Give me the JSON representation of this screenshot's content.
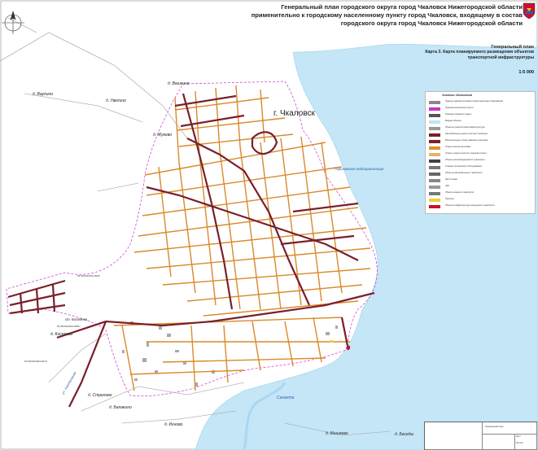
{
  "title": {
    "line1": "Генеральный план городского округа город Чкаловск Нижегородской области",
    "line2": "применительно к городскому населенному пункту город Чкаловск, входящему в состав",
    "line3": "городского округа город Чкаловск Нижегородской области"
  },
  "subtitle": {
    "line1": "Генеральный план",
    "line2": "Карта 3. Карта планируемого размещения объектов",
    "line3": "транспортной инфраструктуры"
  },
  "scale": "1:5 000",
  "labels": {
    "city": "г. Чкаловск",
    "reservoir": "Горьковское водохранилище",
    "river": "Санахта",
    "vashkino": "д. Вашкино",
    "vaulino": "д. Ваулино",
    "uvelino": "д. Увелино",
    "zhukovo": "д. Жуково",
    "kostyanka": "ст. Костянка",
    "kiselevo": "д. Киселево",
    "strelovo": "д. Стрелово",
    "balakino": "д. Балакино",
    "ignovo": "д. Игново",
    "mishino": "д. Мишнево",
    "besedy": "д. Беседы",
    "road": "ул. Аэродромная",
    "cad1": "52:08:0010304:4000",
    "cad2": "52:08:0010304:1886",
    "cad3": "52:08:0010304:4079"
  },
  "legend": {
    "header": "Условные обозначения",
    "items": [
      {
        "text": "Границы административно-территориальных образований",
        "color": "#888888"
      },
      {
        "text": "Граница населенного пункта",
        "color": "#cc33cc"
      },
      {
        "text": "Граница городского округа",
        "color": "#555555"
      },
      {
        "text": "Водные объекты",
        "color": "#bfe3f5"
      },
      {
        "text": "Объекты транспортной инфраструктуры",
        "color": "#999999"
      },
      {
        "text": "Автомобильные дороги местного значения",
        "color": "#7a1f2b"
      },
      {
        "text": "Магистральные улицы районного значения",
        "color": "#7a1f2b"
      },
      {
        "text": "Улицы в жилой застройке",
        "color": "#e0902a"
      },
      {
        "text": "Улицы и дороги местного значения (план.)",
        "color": "#e8b070"
      },
      {
        "text": "Объекты железнодорожного транспорта",
        "color": "#444444"
      },
      {
        "text": "Станции технического обслуживания",
        "color": "#777777"
      },
      {
        "text": "Объекты автомобильного транспорта",
        "color": "#666666"
      },
      {
        "text": "Автостоянки",
        "color": "#888888"
      },
      {
        "text": "АЗС",
        "color": "#999999"
      },
      {
        "text": "Объекты водного транспорта",
        "color": "#777777"
      },
      {
        "text": "Причалы",
        "color": "#e8d23a"
      },
      {
        "text": "Объекты инфраструктуры воздушного транспорта",
        "color": "#c8102e"
      }
    ]
  },
  "stamp": {
    "org": "Генеральный план",
    "sheet": "Лист",
    "sheets": "Листов"
  },
  "colors": {
    "water": "#c4e6f7",
    "land": "#ffffff",
    "main_road": "#7a1f2b",
    "street": "#d98a2a",
    "boundary": "#d24ad2",
    "building": "#a9a9a9"
  }
}
